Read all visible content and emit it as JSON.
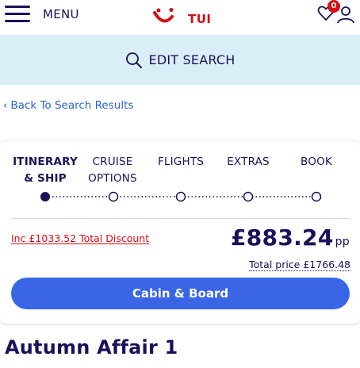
{
  "header": {
    "menu_label": "MENU",
    "logo_text": "TUI",
    "wishlist_count": "0",
    "brand_color": "#d40e14",
    "navy": "#1a115a"
  },
  "search": {
    "edit_label": "EDIT SEARCH"
  },
  "nav": {
    "back_label": "Back To Search Results"
  },
  "steps": [
    {
      "line1": "ITINERARY",
      "line2": "& SHIP",
      "active": true
    },
    {
      "line1": "CRUISE",
      "line2": "OPTIONS",
      "active": false
    },
    {
      "line1": "FLIGHTS",
      "line2": "",
      "active": false
    },
    {
      "line1": "EXTRAS",
      "line2": "",
      "active": false
    },
    {
      "line1": "BOOK",
      "line2": "",
      "active": false
    }
  ],
  "pricing": {
    "discount": "Inc £1033.52 Total Discount",
    "price": "£883.24",
    "per_person": "pp",
    "total": "Total price £1766.48"
  },
  "cta": {
    "label": "Cabin & Board"
  },
  "cruise": {
    "title": "Autumn Affair 1"
  }
}
